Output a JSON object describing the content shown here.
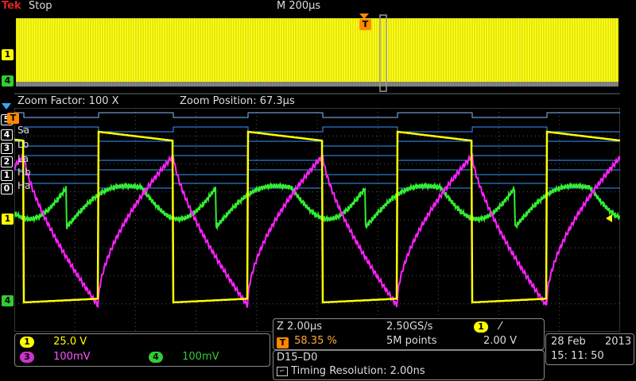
{
  "topbar": {
    "brand_main": "Tek",
    "status": "Stop",
    "timebase": "M 200µs"
  },
  "zoom": {
    "factor_label": "Zoom Factor: 100 X",
    "position_label": "Zoom Position: 67.3µs"
  },
  "channels": {
    "ch1": {
      "num": "1",
      "scale": "25.0 V",
      "color": "#ffff00"
    },
    "ch3": {
      "num": "3",
      "scale": "100mV",
      "color": "#ff33ff"
    },
    "ch4": {
      "num": "4",
      "scale": "100mV",
      "color": "#33cc33"
    }
  },
  "digital_labels": [
    "Sa",
    "Lb",
    "La",
    "Hb",
    "Ha"
  ],
  "digital_indices": [
    "5",
    "4",
    "3",
    "2",
    "1",
    "0"
  ],
  "trigger_marker": "T",
  "acquisition": {
    "zoom_scale": "Z 2.00µs",
    "sample_rate": "2.50GS/s",
    "trigger_pos": "58.35 %",
    "record_length": "5M points",
    "trigger_channel": "1",
    "trigger_slope": "⁄",
    "trigger_level": "2.00 V"
  },
  "bus": {
    "name": "D15–D0",
    "timing": "Timing Resolution: 2.00ns"
  },
  "datetime": {
    "date": "28 Feb",
    "year": "2013",
    "time": "15: 11: 50"
  },
  "colors": {
    "ch1": "#ffff00",
    "ch3": "#ff33ff",
    "ch4": "#33cc33",
    "trigger": "#ff8800",
    "digital": "#33aaff"
  }
}
